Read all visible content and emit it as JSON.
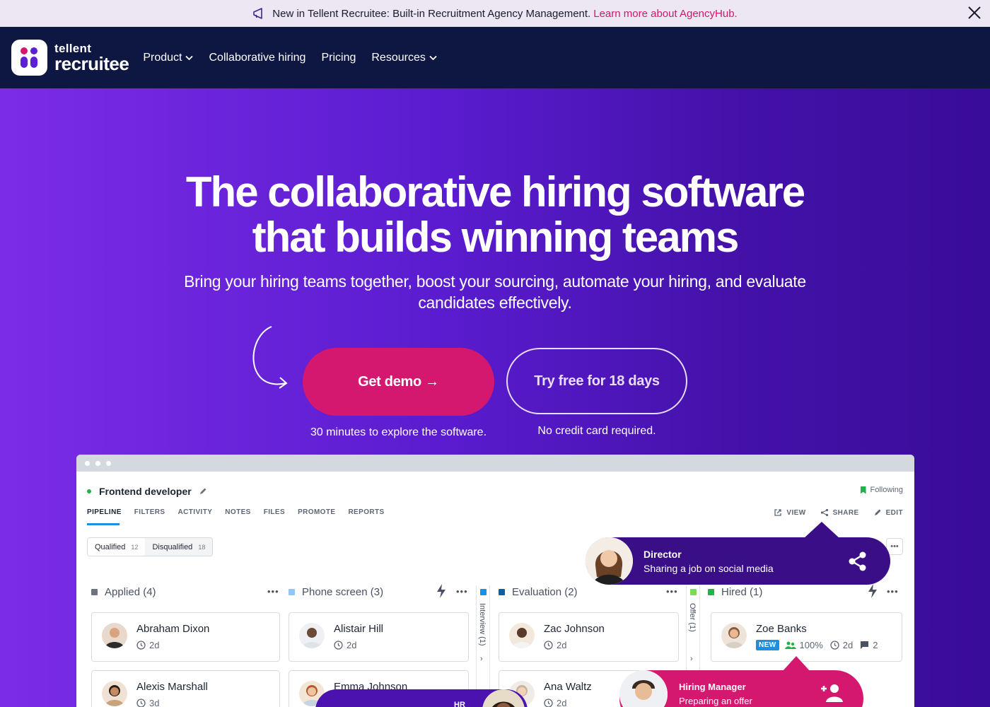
{
  "announcement": {
    "text": "New in Tellent Recruitee: Built-in Recruitment Agency Management.",
    "link": "Learn more about AgencyHub.",
    "megaphone_icon": "megaphone-icon",
    "close_icon": "close-icon"
  },
  "nav": {
    "logo_top": "tellent",
    "logo_bottom": "recruitee",
    "items": [
      {
        "label": "Product",
        "has_dropdown": true
      },
      {
        "label": "Collaborative hiring",
        "has_dropdown": false
      },
      {
        "label": "Pricing",
        "has_dropdown": false
      },
      {
        "label": "Resources",
        "has_dropdown": true
      }
    ]
  },
  "hero": {
    "title_line1": "The collaborative hiring software",
    "title_line2": "that builds winning teams",
    "subtitle": "Bring your hiring teams together, boost your sourcing, automate your hiring, and evaluate candidates effectively.",
    "primary_cta": "Get demo →",
    "secondary_cta": "Try free for 18 days",
    "primary_note": "30 minutes to explore the software.",
    "secondary_note": "No credit card required."
  },
  "app": {
    "job_title": "Frontend developer",
    "following": "Following",
    "tabs": [
      "PIPELINE",
      "FILTERS",
      "ACTIVITY",
      "NOTES",
      "FILES",
      "PROMOTE",
      "REPORTS"
    ],
    "active_tab": "PIPELINE",
    "actions": [
      "VIEW",
      "SHARE",
      "EDIT"
    ],
    "segment": {
      "qualified_label": "Qualified",
      "qualified_count": "12",
      "disqualified_label": "Disqualified",
      "disqualified_count": "18"
    },
    "columns": [
      {
        "label": "Applied (4)",
        "color": "#6b7280"
      },
      {
        "label": "Phone screen (3)",
        "color": "#93c5fd"
      },
      {
        "label": "Interview (1)",
        "color": "#1a8fe3",
        "collapsed": true
      },
      {
        "label": "Evaluation (2)",
        "color": "#0b5fa5"
      },
      {
        "label": "Offer (1)",
        "color": "#7ed957",
        "collapsed": true
      },
      {
        "label": "Hired (1)",
        "color": "#22b14c"
      }
    ],
    "cards": [
      {
        "name": "Abraham Dixon",
        "time": "2d"
      },
      {
        "name": "Alistair Hill",
        "time": "2d"
      },
      {
        "name": "Zac Johnson",
        "time": "2d"
      },
      {
        "name": "Zoe Banks",
        "badge": "NEW",
        "score": "100%",
        "time": "2d",
        "comments": "2"
      },
      {
        "name": "Alexis Marshall",
        "time": "3d"
      },
      {
        "name": "Emma Johnson",
        "time": ""
      },
      {
        "name": "Ana Waltz",
        "time": "2d"
      }
    ]
  },
  "callouts": {
    "director": {
      "role": "Director",
      "text": "Sharing a job on social media"
    },
    "hiring_manager": {
      "role": "Hiring Manager",
      "text": "Preparing an offer"
    },
    "hr": {
      "role": "HR"
    }
  },
  "colors": {
    "accent_pink": "#d4186f",
    "nav_bg": "#0e1642",
    "hero_purple": "#5b1fd6"
  }
}
